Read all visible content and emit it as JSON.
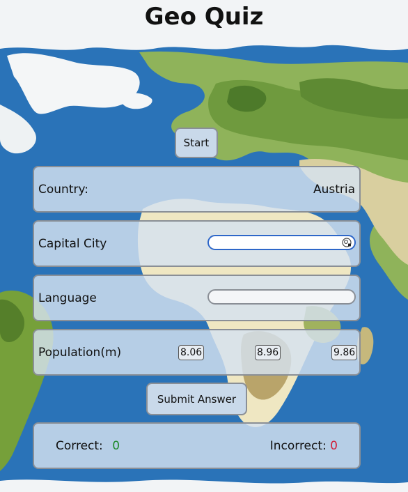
{
  "app": {
    "title": "Geo Quiz"
  },
  "controls": {
    "start_label": "Start",
    "submit_label": "Submit Answer"
  },
  "quiz": {
    "country": {
      "label": "Country:",
      "value": "Austria"
    },
    "capital": {
      "label": "Capital City",
      "value": ""
    },
    "language": {
      "label": "Language",
      "value": ""
    },
    "population": {
      "label": "Population(m)",
      "options": [
        "8.06",
        "8.96",
        "9.86"
      ]
    }
  },
  "score": {
    "correct_label": "Correct:",
    "correct_value": "0",
    "incorrect_label": "Incorrect:",
    "incorrect_value": "0",
    "correct_color": "#1f8a2c",
    "incorrect_color": "#d0213a"
  },
  "icons": {
    "capital_field_icon": "password-manager-icon"
  },
  "colors": {
    "ocean": "#2a73b8",
    "panel": "#d6e2f0",
    "focus_border": "#2e67c9"
  }
}
